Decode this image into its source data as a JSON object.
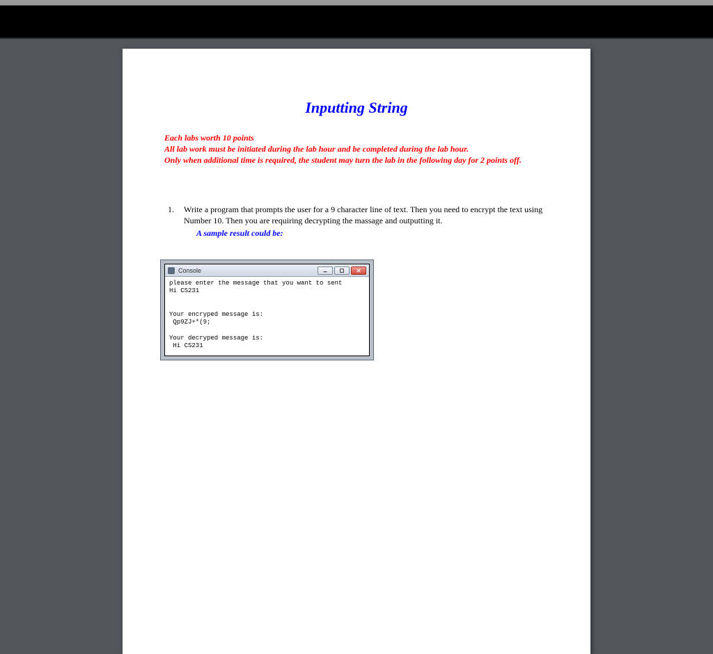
{
  "document": {
    "title": "Inputting String",
    "policy": {
      "line1": "Each labs worth 10 points",
      "line2": "All lab work must be initiated during the lab hour and be completed during the lab hour.",
      "line3": "Only when additional time is required, the student may turn the lab in the following day for 2 points off."
    },
    "question": {
      "number": "1.",
      "text": "Write a program that prompts the user for a 9 character line of text. Then you need to encrypt the text using Number 10. Then you are requiring decrypting the massage and outputting it.",
      "sample_hint": "A sample result could be:"
    },
    "console": {
      "title": "Console",
      "lines": {
        "l1": "please enter the message that you want to sent",
        "l2": "Hi CS231",
        "l3": "",
        "l4": "",
        "l5": "Your encryped message is:",
        "l6": " Qp9ZJ+*(9;",
        "l7": "",
        "l8": "Your decryped message is:",
        "l9": " Hi CS231"
      }
    }
  }
}
